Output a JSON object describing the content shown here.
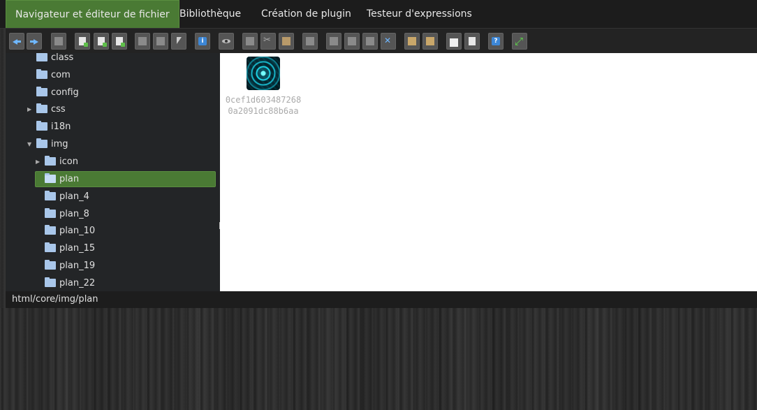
{
  "tabs": [
    {
      "label": "Navigateur et éditeur de fichier",
      "active": true
    },
    {
      "label": "Bibliothèque",
      "active": false
    },
    {
      "label": "Création de plugin",
      "active": false
    },
    {
      "label": "Testeur d'expressions",
      "active": false
    }
  ],
  "tree": [
    {
      "label": "class"
    },
    {
      "label": "com"
    },
    {
      "label": "config"
    },
    {
      "label": "css",
      "expandable": true
    },
    {
      "label": "i18n"
    },
    {
      "label": "img",
      "expanded": true
    },
    {
      "label": "icon",
      "expandable": true
    },
    {
      "label": "plan",
      "selected": true
    },
    {
      "label": "plan_4"
    },
    {
      "label": "plan_8"
    },
    {
      "label": "plan_10"
    },
    {
      "label": "plan_15"
    },
    {
      "label": "plan_19"
    },
    {
      "label": "plan_22"
    }
  ],
  "file": {
    "name_line1": "0cef1d603487268",
    "name_line2": "0a2091dc88b6aa"
  },
  "toolbar_icons": [
    "back-icon",
    "forward-icon",
    "print-icon",
    "new-file-icon",
    "new-folder-icon",
    "save-icon",
    "copy-path-icon",
    "paste-path-icon",
    "select-icon",
    "info-icon",
    "preview-icon",
    "copy-icon",
    "cut-icon",
    "paste-icon",
    "duplicate-icon",
    "rename-icon",
    "select-all-icon",
    "edit-icon",
    "fullscreen-icon",
    "archive-icon",
    "extract-icon",
    "keyboard-icon",
    "dictionary-icon",
    "help-icon",
    "maximize-icon"
  ],
  "status": {
    "path": "html/core/img/plan"
  }
}
